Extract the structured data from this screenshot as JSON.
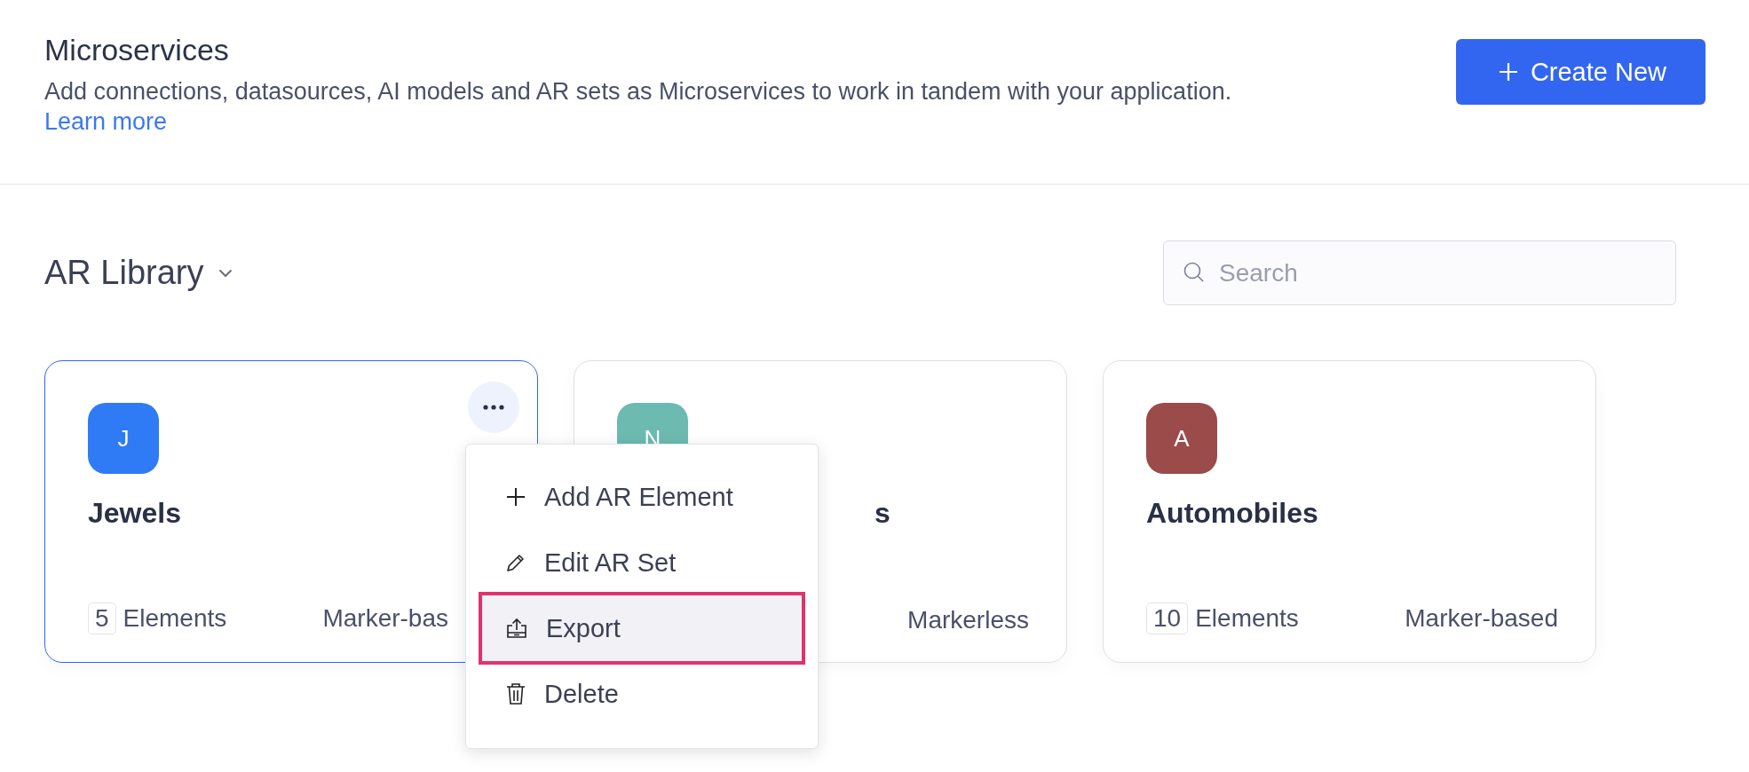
{
  "header": {
    "title": "Microservices",
    "description": "Add connections, datasources, AI models and AR sets as Microservices to work in tandem with your application.",
    "link": "Learn more",
    "create_button": "Create New"
  },
  "library": {
    "title": "AR Library",
    "search": {
      "placeholder": "Search"
    }
  },
  "cards": [
    {
      "avatar": "J",
      "color": "#2f7bf5",
      "name": "Jewels",
      "count": "5",
      "count_label": "Elements",
      "type": "Marker-bas",
      "selected": true
    },
    {
      "avatar": "N",
      "color": "#6cbab0",
      "name": "s",
      "type": "Markerless",
      "selected": false
    },
    {
      "avatar": "A",
      "color": "#9a4b4a",
      "name": "Automobiles",
      "count": "10",
      "count_label": "Elements",
      "type": "Marker-based",
      "selected": false
    }
  ],
  "context_menu": {
    "items": [
      {
        "kind": "plus",
        "label": "Add AR Element",
        "selected": false
      },
      {
        "kind": "pencil",
        "label": "Edit AR Set",
        "selected": false
      },
      {
        "kind": "export",
        "label": "Export",
        "selected": true
      },
      {
        "kind": "trash",
        "label": "Delete",
        "selected": false
      }
    ]
  }
}
